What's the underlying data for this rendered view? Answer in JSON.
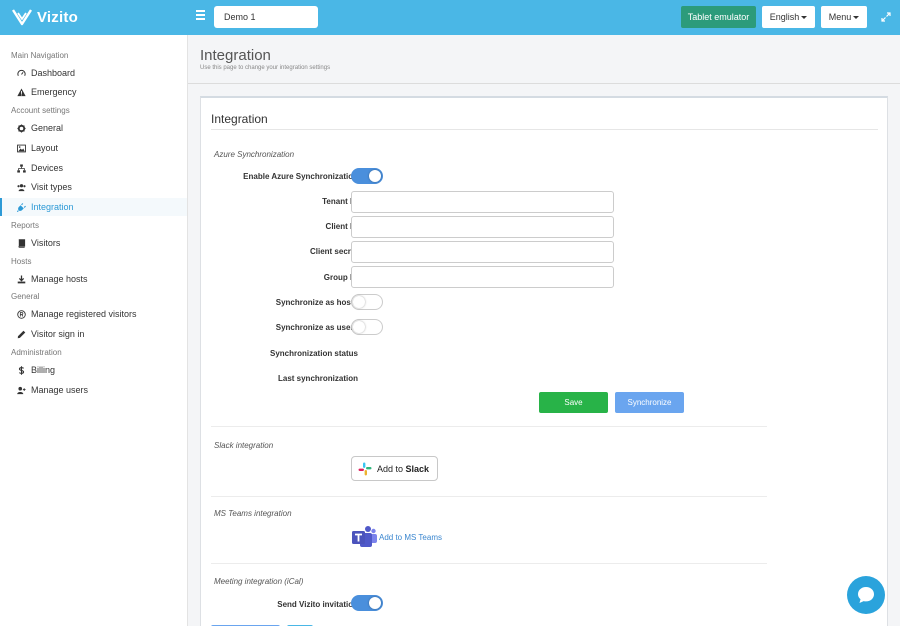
{
  "app": {
    "brand": "Vizito",
    "demo_label": "Demo 1",
    "tablet_button": "Tablet emulator",
    "language_button": "English",
    "menu_button": "Menu",
    "accent_color": "#4ab7e6"
  },
  "sidebar": {
    "sections": [
      {
        "title": "Main Navigation",
        "items": [
          {
            "label": "Dashboard",
            "icon": "gauge-icon"
          },
          {
            "label": "Emergency",
            "icon": "warning-icon"
          }
        ]
      },
      {
        "title": "Account settings",
        "items": [
          {
            "label": "General",
            "icon": "gear-icon"
          },
          {
            "label": "Layout",
            "icon": "image-icon"
          },
          {
            "label": "Devices",
            "icon": "sitemap-icon"
          },
          {
            "label": "Visit types",
            "icon": "users-icon"
          },
          {
            "label": "Integration",
            "icon": "plug-icon",
            "active": true
          }
        ]
      },
      {
        "title": "Reports",
        "items": [
          {
            "label": "Visitors",
            "icon": "book-icon"
          }
        ]
      },
      {
        "title": "Hosts",
        "items": [
          {
            "label": "Manage hosts",
            "icon": "download-icon"
          }
        ]
      },
      {
        "title": "General",
        "items": [
          {
            "label": "Manage registered visitors",
            "icon": "registered-icon"
          },
          {
            "label": "Visitor sign in",
            "icon": "pencil-icon"
          }
        ]
      },
      {
        "title": "Administration",
        "items": [
          {
            "label": "Billing",
            "icon": "dollar-icon"
          },
          {
            "label": "Manage users",
            "icon": "user-plus-icon"
          }
        ]
      }
    ]
  },
  "page": {
    "title": "Integration",
    "subtitle": "Use this page to change your integration settings"
  },
  "panel": {
    "title": "Integration",
    "azure": {
      "section_title": "Azure Synchronization",
      "enable_label": "Enable Azure Synchronization",
      "enable_on": true,
      "tenant_label": "Tenant ID",
      "tenant_value": "",
      "client_label": "Client ID",
      "client_value": "",
      "secret_label": "Client secret",
      "secret_value": "",
      "group_label": "Group ID",
      "group_value": "",
      "sync_hosts_label": "Synchronize as hosts",
      "sync_hosts_on": false,
      "sync_users_label": "Synchronize as users",
      "sync_users_on": false,
      "status_label": "Synchronization status",
      "last_sync_label": "Last synchronization",
      "save_button": "Save",
      "synchronize_button": "Synchronize"
    },
    "slack": {
      "section_title": "Slack integration",
      "button_prefix": "Add to ",
      "button_brand": "Slack"
    },
    "teams": {
      "section_title": "MS Teams integration",
      "link_label": "Add to MS Teams"
    },
    "meeting": {
      "section_title": "Meeting integration (iCal)",
      "send_label": "Send Vizito invitation",
      "send_on": true
    }
  }
}
